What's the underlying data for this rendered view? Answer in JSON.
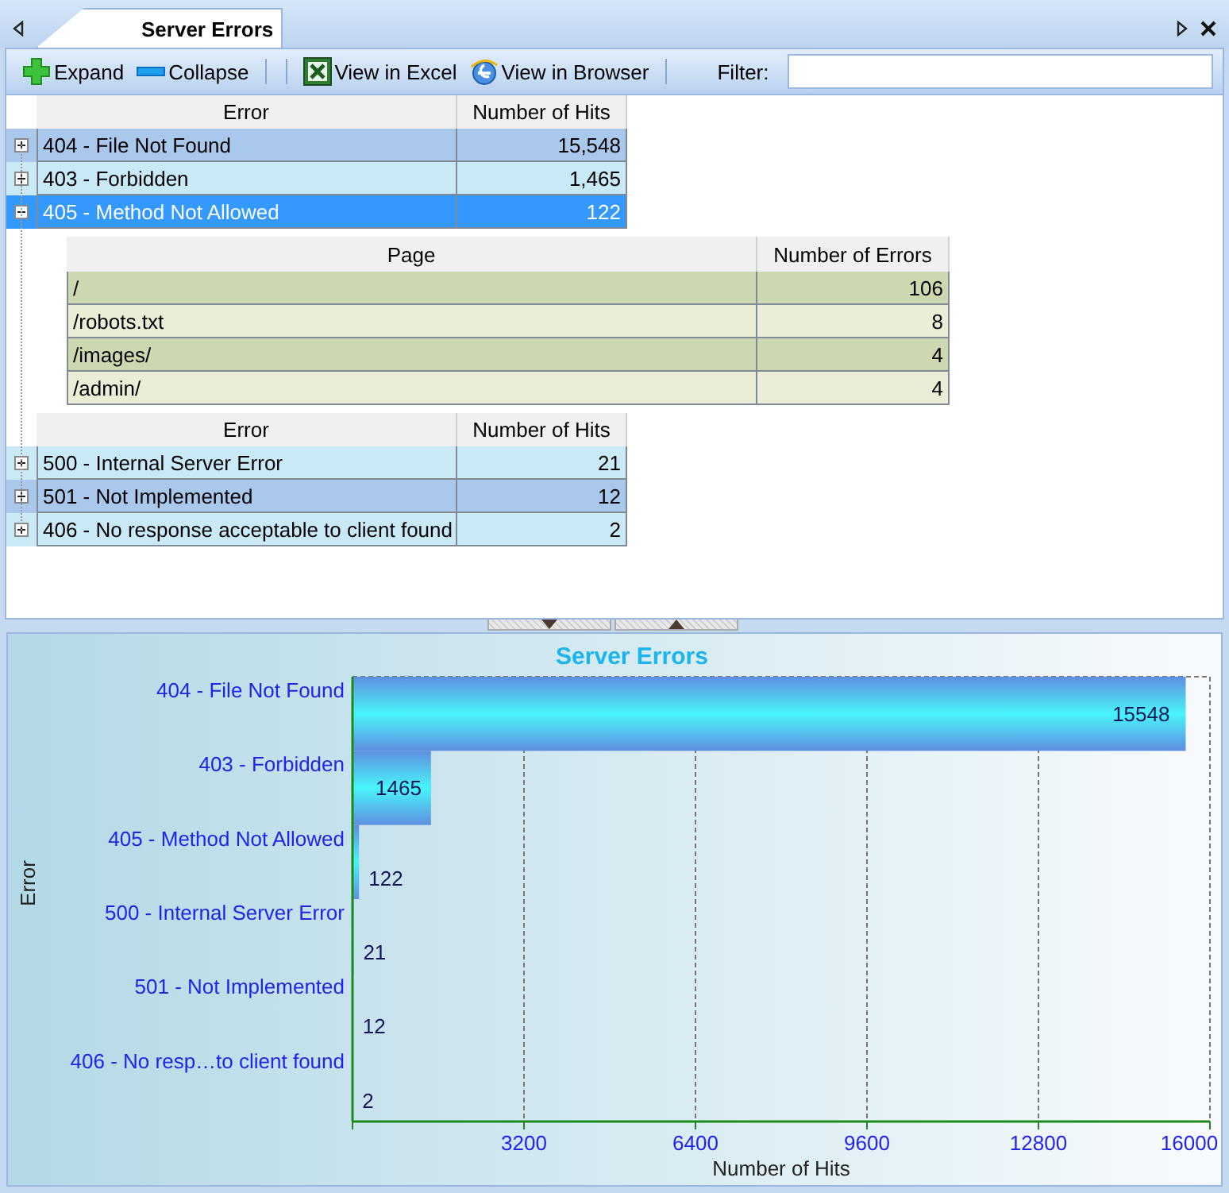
{
  "tab": {
    "title": "Server Errors",
    "selected": true
  },
  "toolbar": {
    "buttons": [
      {
        "kind": "expand",
        "label": "Expand"
      },
      {
        "kind": "collapse",
        "label": "Collapse"
      },
      {
        "kind": "excel",
        "label": "View in Excel"
      },
      {
        "kind": "browser",
        "label": "View in Browser"
      }
    ],
    "filter_label": "Filter:"
  },
  "grid": {
    "sections": [
      {
        "columns": [
          "Error",
          "Number of Hits"
        ],
        "rows": [
          {
            "error": "404 - File Not Found",
            "hits": "15,548",
            "expanded": false,
            "selected": false
          },
          {
            "error": "403 - Forbidden",
            "hits": "1,465",
            "expanded": false,
            "selected": false
          },
          {
            "error": "405 - Method Not Allowed",
            "hits": "122",
            "expanded": true,
            "selected": true,
            "detail": {
              "columns": [
                "Page",
                "Number of Errors"
              ],
              "rows": [
                {
                  "page": "/",
                  "errors": "106"
                },
                {
                  "page": "/robots.txt",
                  "errors": "8"
                },
                {
                  "page": "/images/",
                  "errors": "4"
                },
                {
                  "page": "/admin/",
                  "errors": "4"
                }
              ]
            }
          }
        ]
      },
      {
        "columns": [
          "Error",
          "Number of Hits"
        ],
        "rows": [
          {
            "error": "500 - Internal Server Error",
            "hits": "21",
            "expanded": false,
            "selected": false
          },
          {
            "error": "501 - Not Implemented",
            "hits": "12",
            "expanded": false,
            "selected": false
          },
          {
            "error": "406 - No response acceptable to client found",
            "hits": "2",
            "expanded": false,
            "selected": false
          }
        ]
      }
    ]
  },
  "chart": {
    "chart_data": {
      "type": "bar",
      "orientation": "horizontal",
      "title": "Server Errors",
      "xlabel": "Number of Hits",
      "ylabel": "Error",
      "categories": [
        "404 - File Not Found",
        "403 - Forbidden",
        "405 - Method Not Allowed",
        "500 - Internal Server Error",
        "501 - Not Implemented",
        "406 - No resp…to client found"
      ],
      "values": [
        15548,
        1465,
        122,
        21,
        12,
        2
      ],
      "xlim": [
        0,
        16000
      ],
      "xticks": [
        3200,
        6400,
        9600,
        12800,
        16000
      ],
      "data_labels": true,
      "grid": true
    }
  }
}
